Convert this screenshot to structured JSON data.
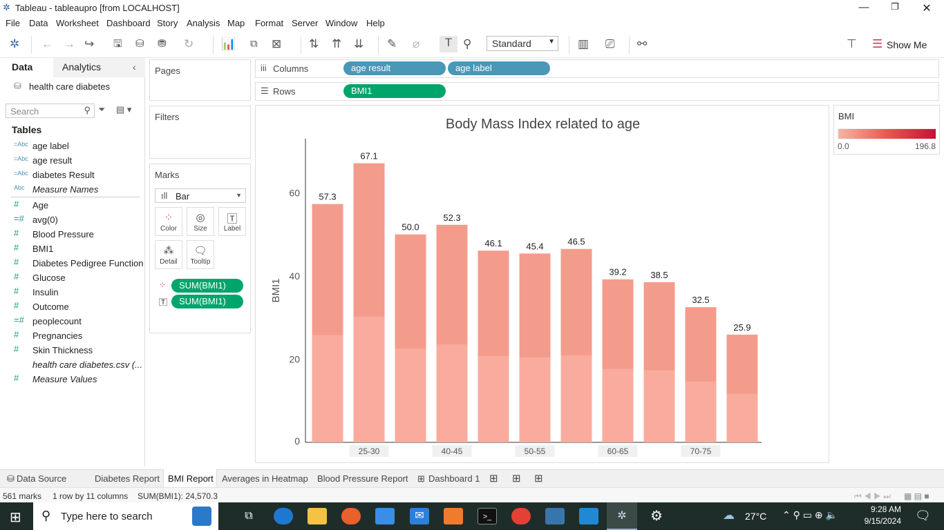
{
  "window": {
    "title": "Tableau - tableaupro [from LOCALHOST]"
  },
  "menu": [
    "File",
    "Data",
    "Worksheet",
    "Dashboard",
    "Story",
    "Analysis",
    "Map",
    "Format",
    "Server",
    "Window",
    "Help"
  ],
  "toolbar": {
    "fit": "Standard",
    "show_me": "Show Me"
  },
  "left_pane": {
    "tab_data": "Data",
    "tab_analytics": "Analytics",
    "datasource": "health care diabetes",
    "search_placeholder": "Search",
    "tables_heading": "Tables",
    "dimensions": [
      {
        "icon": "=Abc",
        "name": "age label",
        "italic": false
      },
      {
        "icon": "=Abc",
        "name": "age result",
        "italic": false
      },
      {
        "icon": "=Abc",
        "name": "diabetes Result",
        "italic": false
      },
      {
        "icon": "Abc",
        "name": "Measure Names",
        "italic": true
      }
    ],
    "measures": [
      {
        "icon": "#",
        "name": "Age",
        "italic": false
      },
      {
        "icon": "=#",
        "name": "avg(0)",
        "italic": false
      },
      {
        "icon": "#",
        "name": "Blood Pressure",
        "italic": false
      },
      {
        "icon": "#",
        "name": "BMI1",
        "italic": false
      },
      {
        "icon": "#",
        "name": "Diabetes Pedigree Function",
        "italic": false
      },
      {
        "icon": "#",
        "name": "Glucose",
        "italic": false
      },
      {
        "icon": "#",
        "name": "Insulin",
        "italic": false
      },
      {
        "icon": "#",
        "name": "Outcome",
        "italic": false
      },
      {
        "icon": "=#",
        "name": "peoplecount",
        "italic": false
      },
      {
        "icon": "#",
        "name": "Pregnancies",
        "italic": false
      },
      {
        "icon": "#",
        "name": "Skin Thickness",
        "italic": false
      },
      {
        "icon": "",
        "name": "health care diabetes.csv (...",
        "italic": true
      },
      {
        "icon": "#",
        "name": "Measure Values",
        "italic": true
      }
    ]
  },
  "shelves": {
    "pages": "Pages",
    "filters": "Filters",
    "marks": "Marks",
    "mark_type": "Bar",
    "mark_buttons": [
      "Color",
      "Size",
      "Label",
      "Detail",
      "Tooltip"
    ],
    "mark_pills": [
      "SUM(BMI1)",
      "SUM(BMI1)"
    ],
    "columns_label": "Columns",
    "columns": [
      "age result",
      "age label"
    ],
    "rows_label": "Rows",
    "rows": [
      "BMI1"
    ]
  },
  "legend": {
    "title": "BMI",
    "min": "0.0",
    "max": "196.8",
    "colors": [
      "#f9b3a7",
      "#e55a50",
      "#c21335"
    ]
  },
  "chart_data": {
    "type": "bar",
    "title": "Body Mass Index related to age",
    "ylabel": "BMI1",
    "xlabel": "",
    "ylim": [
      0,
      73
    ],
    "yticks": [
      0,
      20,
      40,
      60
    ],
    "categories": [
      "",
      "25-30",
      "",
      "40-45",
      "",
      "50-55",
      "",
      "60-65",
      "",
      "70-75",
      ""
    ],
    "values": [
      57.3,
      67.1,
      50.0,
      52.3,
      46.1,
      45.4,
      46.5,
      39.2,
      38.5,
      32.5,
      25.9
    ],
    "labels": [
      "57.3",
      "67.1",
      "50.0",
      "52.3",
      "46.1",
      "45.4",
      "46.5",
      "39.2",
      "38.5",
      "32.5",
      "25.9"
    ],
    "bar_color": "#f28b78"
  },
  "sheet_tabs": [
    "Data Source",
    "Diabetes Report",
    "BMI Report",
    "Averages in Heatmap",
    "Blood Pressure Report",
    "Dashboard 1"
  ],
  "active_tab": "BMI Report",
  "status": {
    "marks": "561 marks",
    "rows_cols": "1 row by 11 columns",
    "sum": "SUM(BMI1): 24,570.3"
  },
  "taskbar": {
    "search": "Type here to search",
    "temp": "27°C",
    "time": "9:28 AM",
    "date": "9/15/2024"
  }
}
